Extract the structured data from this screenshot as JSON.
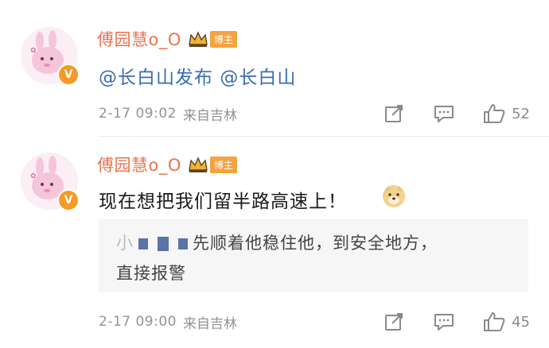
{
  "comments": [
    {
      "username": "傅园慧o_O",
      "badge": "博主",
      "text_mentions": [
        "@长白山发布",
        "@长白山"
      ],
      "time": "2-17 09:02",
      "source": "来自吉林",
      "likes": "52"
    },
    {
      "username": "傅园慧o_O",
      "badge": "博主",
      "text": "现在想把我们留半路高速上！",
      "reply": {
        "prefix": "小",
        "line1": "先顺着他稳住他，到安全地方，",
        "line2": "直接报警"
      },
      "time": "2-17 09:00",
      "source": "来自吉林",
      "likes": "45"
    }
  ],
  "colors": {
    "username": "#eb7350",
    "mention": "#3a6db3",
    "badge": "#f4a340",
    "vip": "#f59a23"
  },
  "icons": [
    "share-icon",
    "comment-icon",
    "like-icon",
    "doge-emoji",
    "crown-icon",
    "verified-icon"
  ]
}
